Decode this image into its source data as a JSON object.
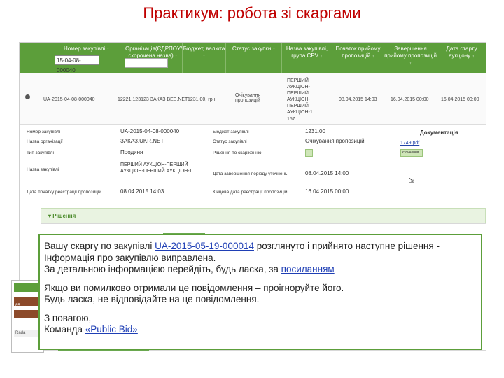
{
  "slide": {
    "title": "Практикум: робота зі скаргами"
  },
  "table": {
    "headers": [
      {
        "label": "Номер закупівлі",
        "sort": "↕"
      },
      {
        "label": "Організація(ЄДРПОУ/ скорочена назва)",
        "sort": "↕"
      },
      {
        "label": "Бюджет, валюта",
        "sort": "↕"
      },
      {
        "label": "Статус закупки",
        "sort": "↕"
      },
      {
        "label": "Назва закупівлі, група CPV",
        "sort": "↕"
      },
      {
        "label": "Початок прийому пропозицій",
        "sort": "↕"
      },
      {
        "label": "Завершення прийому пропозицій",
        "sort": "↕"
      },
      {
        "label": "Дата старту аукціону",
        "sort": "↕"
      }
    ],
    "search_value": "15-04-08-000040",
    "row": {
      "id": "UA-2015-04-08-000040",
      "org": "12221 123123 ЗАКАЗ ВЕБ.NET",
      "budget": "1231.00, грн",
      "status": "Очікування пропозицій",
      "name": "ПЕРШИЙ АУКЦІОН-ПЕРШИЙ АУКЦІОН-ПЕРШИЙ АУКЦІОН-1",
      "cpv": "157",
      "start": "08.04.2015 14:03",
      "end": "16.04.2015 00:00",
      "auction": "16.04.2015 00:00"
    }
  },
  "detail": {
    "labels": {
      "id": "Номер закупівлі",
      "org": "Назва організації",
      "type": "Тип закупівлі",
      "name": "Назва закупівлі",
      "date": "Дата початку реєстрації пропозицій",
      "budget": "Бюджет закупівлі",
      "status": "Статус закупівлі",
      "complaint": "Рішення по скарженню",
      "clar": "Дата завершення періоду уточнень",
      "end": "Кінцева дата реєстрації пропозицій"
    },
    "values": {
      "id": "UA-2015-04-08-000040",
      "org": "ЗАКАЗ.UKR.NET",
      "type": "Поодиня",
      "name": "ПЕРШИЙ АУКЦІОН-ПЕРШИЙ АУКЦІОН-ПЕРШИЙ АУКЦІОН-1",
      "date": "08.04.2015 14:03",
      "budget": "1231.00",
      "status": "Очікування пропозицій",
      "clar": "08.04.2015 14:00",
      "end": "16.04.2015 00:00"
    },
    "documents": {
      "title": "Документація",
      "file": "1749.pdf",
      "note": "Уточнення"
    }
  },
  "solutions": {
    "title": "Рішення"
  },
  "message": {
    "line1_pre": "Вашу скаргу по закупівлі ",
    "line1_link": "UA-2015-05-19-000014",
    "line1_post": " розглянуто і прийнято наступне рішення -",
    "line2": "Інформація про закупівлю виправлена.",
    "line3_pre": "За детальною інформацією перейдіть, будь ласка, за ",
    "line3_link": "посиланням",
    "line4": "Якщо ви помилково отримали це повідомлення – проігноруйте його.",
    "line5": "Будь ласка, не відповідайте на це повідомлення.",
    "line6": "З повагою,",
    "line7_pre": "Команда ",
    "line7_link": "«Public Bid»"
  },
  "left_frame": {
    "code": "85",
    "label": "Rada"
  }
}
